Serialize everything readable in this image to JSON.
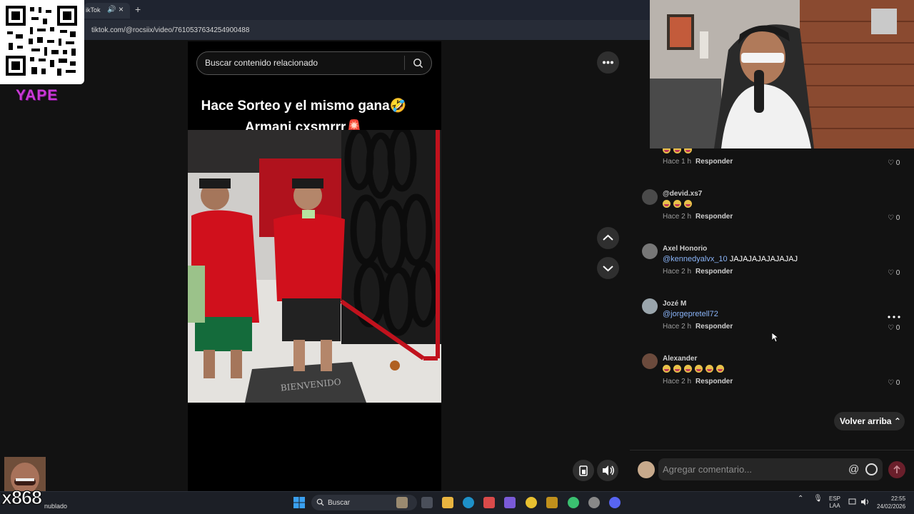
{
  "browser": {
    "tab_title": "ikTok",
    "new_tab": "+",
    "tab_close": "×",
    "url": "tiktok.com/@rocsiix/video/7610537634254900488"
  },
  "overlay": {
    "yape_label": "YAPE",
    "channel_tag": "x868",
    "weather": "nublado"
  },
  "video": {
    "search_placeholder": "Buscar contenido relacionado",
    "caption_line1": "Hace Sorteo y el mismo gana🤣",
    "caption_line2": "Armani cxsmrrr🚨",
    "floor_mat_text": "BIENVENIDO"
  },
  "comments": {
    "items": [
      {
        "user": "",
        "text": "",
        "emoji_count": 3,
        "time": "Hace 1 h",
        "reply": "Responder",
        "likes": "0"
      },
      {
        "user": "@devid.xs7",
        "text": "",
        "emoji_count": 3,
        "time": "Hace 2 h",
        "reply": "Responder",
        "likes": "0"
      },
      {
        "user": "Axel Honorio",
        "mention": "@kennedyalvx_10",
        "text": "JAJAJAJAJAJAJAJ",
        "time": "Hace 2 h",
        "reply": "Responder",
        "likes": "0"
      },
      {
        "user": "Jozé M",
        "mention": "@jorgepretell72",
        "text": "",
        "time": "Hace 2 h",
        "reply": "Responder",
        "likes": "0"
      },
      {
        "user": "Alexander",
        "text": "",
        "emoji_count": 6,
        "time": "Hace 2 h",
        "reply": "Responder",
        "likes": "0"
      }
    ],
    "back_to_top": "Volver arriba",
    "input_placeholder": "Agregar comentario...",
    "at_symbol": "@"
  },
  "taskbar": {
    "search_label": "Buscar",
    "lang_line1": "ESP",
    "lang_line2": "LAA",
    "time": "22:55",
    "date": "24/02/2026"
  },
  "colors": {
    "yape": "#c93ad6",
    "mention": "#8ab4f8",
    "send": "#6a1f2b"
  }
}
